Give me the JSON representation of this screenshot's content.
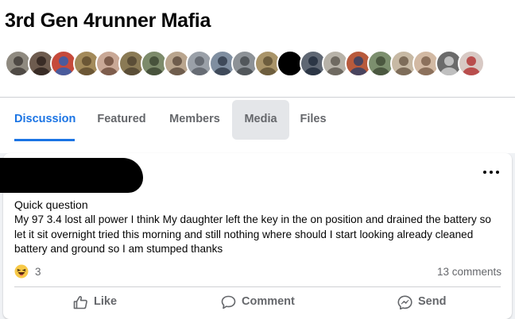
{
  "group": {
    "title": "3rd Gen 4runner Mafia"
  },
  "members": {
    "avatars": [
      {
        "name": "member-avatar-1",
        "bg": "#8f8a80",
        "fg": "#3e3a36"
      },
      {
        "name": "member-avatar-2",
        "bg": "#6e5c4f",
        "fg": "#2c211b"
      },
      {
        "name": "member-avatar-3",
        "bg": "#c64a3b",
        "fg": "#2a5fb5"
      },
      {
        "name": "member-avatar-4",
        "bg": "#a38a5a",
        "fg": "#5e4a2c"
      },
      {
        "name": "member-avatar-5",
        "bg": "#c9a896",
        "fg": "#6b4a3a"
      },
      {
        "name": "member-avatar-6",
        "bg": "#8a7a55",
        "fg": "#4f4430"
      },
      {
        "name": "member-avatar-7",
        "bg": "#7d8b6b",
        "fg": "#3b4531"
      },
      {
        "name": "member-avatar-8",
        "bg": "#b9a58e",
        "fg": "#5c4b3d"
      },
      {
        "name": "member-avatar-9",
        "bg": "#9aa0a8",
        "fg": "#5a5f66"
      },
      {
        "name": "member-avatar-10",
        "bg": "#7f8ea0",
        "fg": "#2f3a48"
      },
      {
        "name": "member-avatar-11",
        "bg": "#8d9297",
        "fg": "#44484c"
      },
      {
        "name": "member-avatar-12",
        "bg": "#a99469",
        "fg": "#5f5033"
      },
      {
        "name": "member-avatar-13",
        "bg": "#000000",
        "fg": "#000000"
      },
      {
        "name": "member-avatar-14",
        "bg": "#5f6773",
        "fg": "#1f2a3a"
      },
      {
        "name": "member-avatar-15",
        "bg": "#b7b2a8",
        "fg": "#5c574f"
      },
      {
        "name": "member-avatar-16",
        "bg": "#b85a3c",
        "fg": "#2d3f66"
      },
      {
        "name": "member-avatar-17",
        "bg": "#7c8f6e",
        "fg": "#3e4a35"
      },
      {
        "name": "member-avatar-18",
        "bg": "#c7b9a4",
        "fg": "#6b5a47"
      },
      {
        "name": "member-avatar-19",
        "bg": "#d2b9a3",
        "fg": "#7a5f4a"
      },
      {
        "name": "member-avatar-20",
        "bg": "#6b6b6b",
        "fg": "#d5d5d5"
      },
      {
        "name": "member-avatar-21",
        "bg": "#d8c9c4",
        "fg": "#b12f2f"
      }
    ]
  },
  "tabs": [
    {
      "label": "Discussion",
      "name": "tab-discussion"
    },
    {
      "label": "Featured",
      "name": "tab-featured"
    },
    {
      "label": "Members",
      "name": "tab-members"
    },
    {
      "label": "Media",
      "name": "tab-media"
    },
    {
      "label": "Files",
      "name": "tab-files"
    }
  ],
  "post": {
    "title": "Quick question",
    "body": "My 97 3.4 lost all power I think My daughter left the key in the on position and drained the battery so let it sit overnight tried this morning and still nothing where should I start looking already cleaned battery and ground so I am stumped thanks",
    "reaction_count": "3",
    "comments": "13 comments",
    "actions": {
      "like": "Like",
      "comment": "Comment",
      "send": "Send"
    }
  },
  "colors": {
    "accent": "#1b74e4",
    "secondary_text": "#65676b",
    "background": "#f0f2f5"
  },
  "icons": {
    "more": "more-options-icon",
    "reaction": "haha-reaction-icon",
    "like": "thumbs-up-icon",
    "comment": "comment-bubble-icon",
    "send": "messenger-send-icon"
  }
}
